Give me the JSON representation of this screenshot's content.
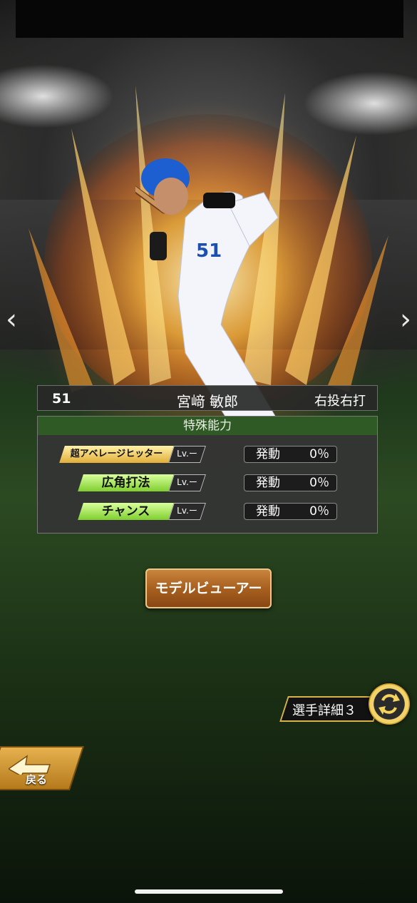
{
  "player": {
    "number": "51",
    "name": "宮﨑 敏郎",
    "hand": "右投右打"
  },
  "abilities": {
    "title": "特殊能力",
    "items": [
      {
        "name": "超アベレージヒッター",
        "badge": "超",
        "level": "Lv.ー",
        "activate_label": "発動",
        "rate": "0％",
        "color": "#f4cf60"
      },
      {
        "name": "広角打法",
        "level": "Lv.ー",
        "activate_label": "発動",
        "rate": "0％",
        "color": "#a8e85a"
      },
      {
        "name": "チャンス",
        "level": "Lv.ー",
        "activate_label": "発動",
        "rate": "0％",
        "color": "#a8e85a"
      }
    ]
  },
  "buttons": {
    "model_viewer": "モデルビューアー",
    "detail": "選手詳細３",
    "back": "戻る"
  },
  "nav": {
    "prev": "‹",
    "next": "›"
  }
}
